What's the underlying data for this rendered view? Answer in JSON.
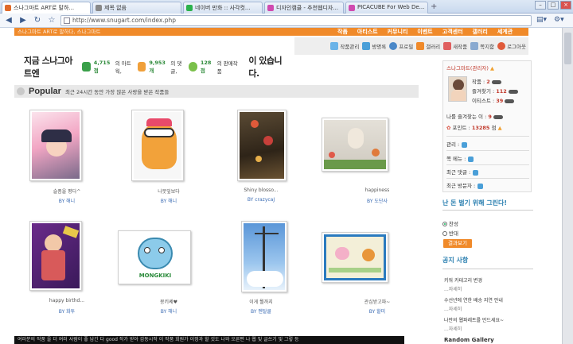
{
  "browser": {
    "tabs": [
      {
        "label": "스나그마트 ART로 말하...",
        "active": true,
        "color": "#e06a2a"
      },
      {
        "label": "제목 없음",
        "active": false,
        "color": "#888888"
      },
      {
        "label": "네이버 만화 :: 사각컷...",
        "active": false,
        "color": "#2bb24c"
      },
      {
        "label": "디자인캠클 - 추천웹디자...",
        "active": false,
        "color": "#d04ab0"
      },
      {
        "label": "PICACUBE For Web De...",
        "active": false,
        "color": "#d04ab0"
      }
    ],
    "url": "http://www.snugart.com/index.php"
  },
  "site": {
    "title": "스나그마트 ART로 말하다, 스나그마트",
    "menu": [
      "작품",
      "아티스트",
      "커뮤니티",
      "이벤트",
      "고객센터",
      "갤러리",
      "세계관",
      "소개",
      "고객",
      "포트폴리오"
    ],
    "userbar": [
      {
        "label": "작품관리",
        "icon": "frame-icon",
        "color": "#6ab3e8"
      },
      {
        "label": "방명록",
        "icon": "book-icon",
        "color": "#4a9fd8"
      },
      {
        "label": "프로필",
        "icon": "person-icon",
        "color": "#4a88c8"
      },
      {
        "label": "갤러리",
        "icon": "house-icon",
        "color": "#f08a2a"
      },
      {
        "label": "새작품",
        "icon": "pencil-icon",
        "color": "#e06060"
      },
      {
        "label": "쪽지함",
        "icon": "envelope-icon",
        "color": "#8aaad0"
      },
      {
        "label": "로그아웃",
        "icon": "logout-icon",
        "color": "#e05a3a"
      }
    ]
  },
  "stats": {
    "prefix": "지금 스나그아트엔",
    "artworks": "4,715점",
    "artworks_label": "의 아트웍,",
    "comments": "9,953개",
    "comments_label": "의 댓글,",
    "sales": "128점",
    "sales_label": "의 판매작품",
    "suffix": "이 있습니다."
  },
  "popular": {
    "title": "Popular",
    "subtitle": "최근 24시간 동안 가장 많은 사랑을 받은 작품들",
    "items": [
      {
        "caption": "슬픔을 평다^",
        "by": "BY 해니",
        "colors": [
          "#f8c8d8",
          "#e890b0",
          "#3a3a5a"
        ]
      },
      {
        "caption": "나뭇잎보다",
        "by": "BY 해니",
        "colors": [
          "#f5f5f5",
          "#f2a23a",
          "#7a4a2a"
        ]
      },
      {
        "caption": "Shiny blosso...",
        "by": "BY crazycaJ",
        "colors": [
          "#4a3a2a",
          "#c84a3a",
          "#a88a5a"
        ]
      },
      {
        "caption": "happiness",
        "by": "BY 도단사",
        "colors": [
          "#dcd8d0",
          "#e88a7a",
          "#3a7a3a"
        ]
      },
      {
        "caption": "happy birthd...",
        "by": "BY 화투",
        "colors": [
          "#7a2a8a",
          "#e8c84a",
          "#d85a5a"
        ]
      },
      {
        "caption": "몽키쎄♥",
        "by": "BY 해니",
        "colors": [
          "#ffffff",
          "#7ac8e8",
          "#2a8a3a"
        ]
      },
      {
        "caption": "이게 뭘까지",
        "by": "BY 멘탈쿨",
        "colors": [
          "#7ab0e0",
          "#ffffff",
          "#3a3a3a"
        ]
      },
      {
        "caption": "관심받고파~",
        "by": "BY 할미",
        "colors": [
          "#e8f0d8",
          "#f0b0c8",
          "#e08a3a"
        ]
      }
    ]
  },
  "footer_text": "여러분의 작품 을 더 여러 사람이 좋 남긴 다 good 작가 받아 감동시작 이 작품 회원가 이정과 할 것도 나와 오른편 나 웹 및 글쓰기 및 그렇 등",
  "sidebar": {
    "username": "스나그마트",
    "role": "(관리자)",
    "stats": [
      {
        "label": "작품",
        "value": "2"
      },
      {
        "label": "즐겨찾기",
        "value": "112"
      },
      {
        "label": "이티스트",
        "value": "39"
      }
    ],
    "fav_me_label": "나를 즐겨찾는 이",
    "fav_me_value": "9",
    "points_label": "포인트",
    "points_value": "13285",
    "points_unit": "점",
    "links": [
      "관리 :",
      "쪽 메뉴 :",
      "최근 댓글 :",
      "최근 방문자 :"
    ],
    "poll_title": "난 돈 벌기 위해 그린다!",
    "poll_options": [
      "찬성",
      "반대"
    ],
    "vote_button": "결과보기",
    "notice_title": "공지 사항",
    "notices": [
      "키워 카테고리 변경",
      "...자세히",
      "수선년에 연한 배송 지연 안내",
      "...자세히",
      "나만의 웹파레트를 만드세요~",
      "...자세히"
    ],
    "next_title": "Random Gallery"
  }
}
